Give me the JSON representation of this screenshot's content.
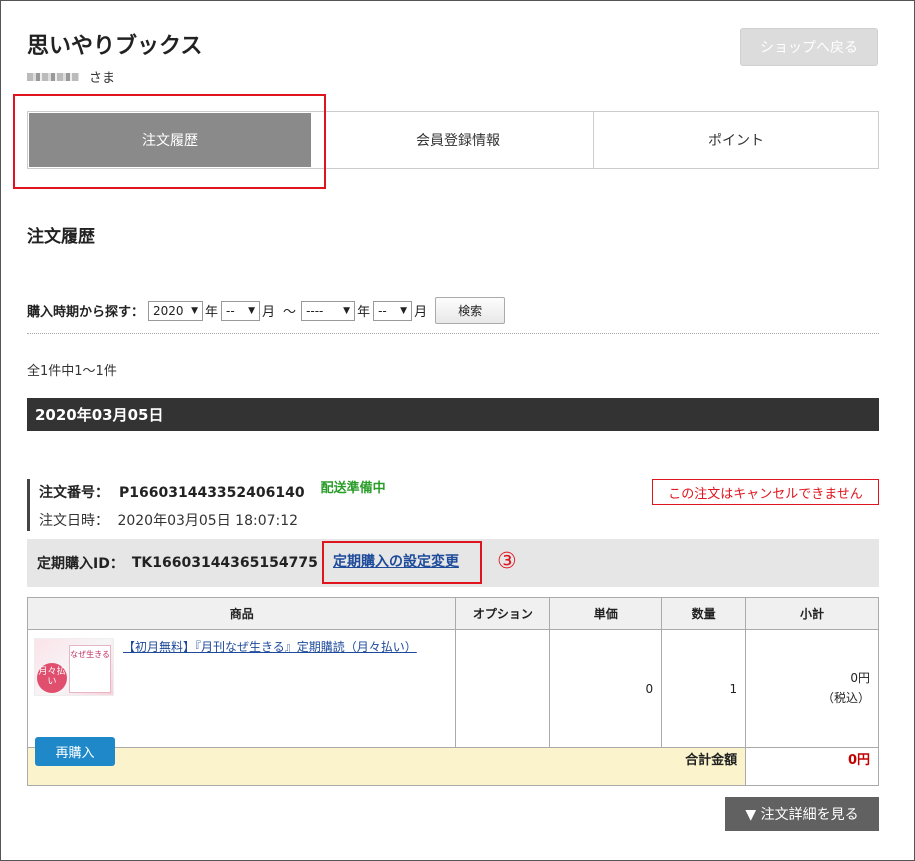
{
  "header": {
    "shop_title": "思いやりブックス",
    "user_suffix": "さま",
    "back_label": "ショップへ戻る"
  },
  "tabs": [
    {
      "label": "注文履歴",
      "active": true
    },
    {
      "label": "会員登録情報",
      "active": false
    },
    {
      "label": "ポイント",
      "active": false
    }
  ],
  "section_title": "注文履歴",
  "search": {
    "label": "購入時期から探す：",
    "year_from": "2020",
    "year_unit": "年",
    "month_from": "--",
    "month_unit": "月",
    "range_sep": "～",
    "year_to": "----",
    "month_to": "--",
    "button_label": "検索"
  },
  "result_count": "全1件中1～1件",
  "order": {
    "date_header": "2020年03月05日",
    "number_label": "注文番号：",
    "number": "P166031443352406140",
    "status": "配送準備中",
    "datetime_label": "注文日時：",
    "datetime": "2020年03月05日 18:07:12",
    "cancel_note": "この注文はキャンセルできません",
    "subscription_label": "定期購入ID：",
    "subscription_id": "TK16603144365154775",
    "subscription_link": "定期購入の設定変更",
    "annotation_marker": "③"
  },
  "table": {
    "headers": [
      "商品",
      "オプション",
      "単価",
      "数量",
      "小計"
    ],
    "rows": [
      {
        "product": "【初月無料】『月刊なぜ生きる』定期購読（月々払い）",
        "thumb_badge": "月々払い",
        "thumb_title": "なぜ生きる",
        "option": "",
        "unit_price": "0",
        "quantity": "1",
        "subtotal": "0円",
        "tax_note": "（税込）",
        "rebuy_label": "再購入"
      }
    ],
    "total_label": "合計金額",
    "total_value": "0円"
  },
  "detail_button": "▼ 注文詳細を見る",
  "colors": {
    "highlight": "#e0141e",
    "status_green": "#2a9d2a",
    "link_blue": "#1d4a9a",
    "rebuy_blue": "#1e88c8",
    "total_bg": "#fbf3cc"
  }
}
